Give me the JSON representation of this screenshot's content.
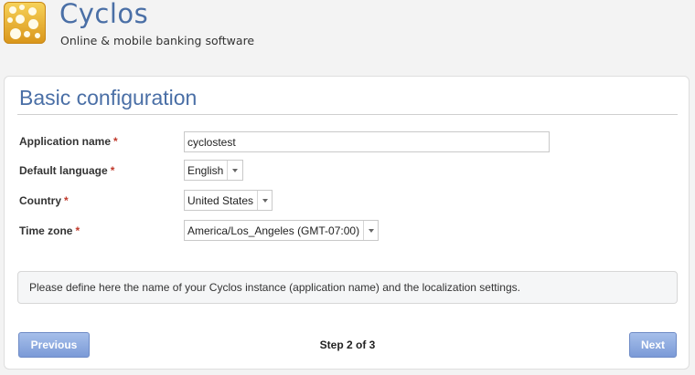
{
  "brand": {
    "name": "Cyclos",
    "tagline": "Online & mobile banking software"
  },
  "page": {
    "title": "Basic configuration"
  },
  "form": {
    "required_marker": "*",
    "application_name": {
      "label": "Application name",
      "value": "cyclostest"
    },
    "default_language": {
      "label": "Default language",
      "value": "English"
    },
    "country": {
      "label": "Country",
      "value": "United States"
    },
    "time_zone": {
      "label": "Time zone",
      "value": "America/Los_Angeles (GMT-07:00)"
    }
  },
  "info": {
    "text": "Please define here the name of your Cyclos instance (application name) and the localization settings."
  },
  "wizard": {
    "previous_label": "Previous",
    "step_text": "Step 2 of 3",
    "next_label": "Next"
  },
  "colors": {
    "accent": "#4a6fa6",
    "button": "#7b9ad7",
    "required": "#c0392b"
  }
}
